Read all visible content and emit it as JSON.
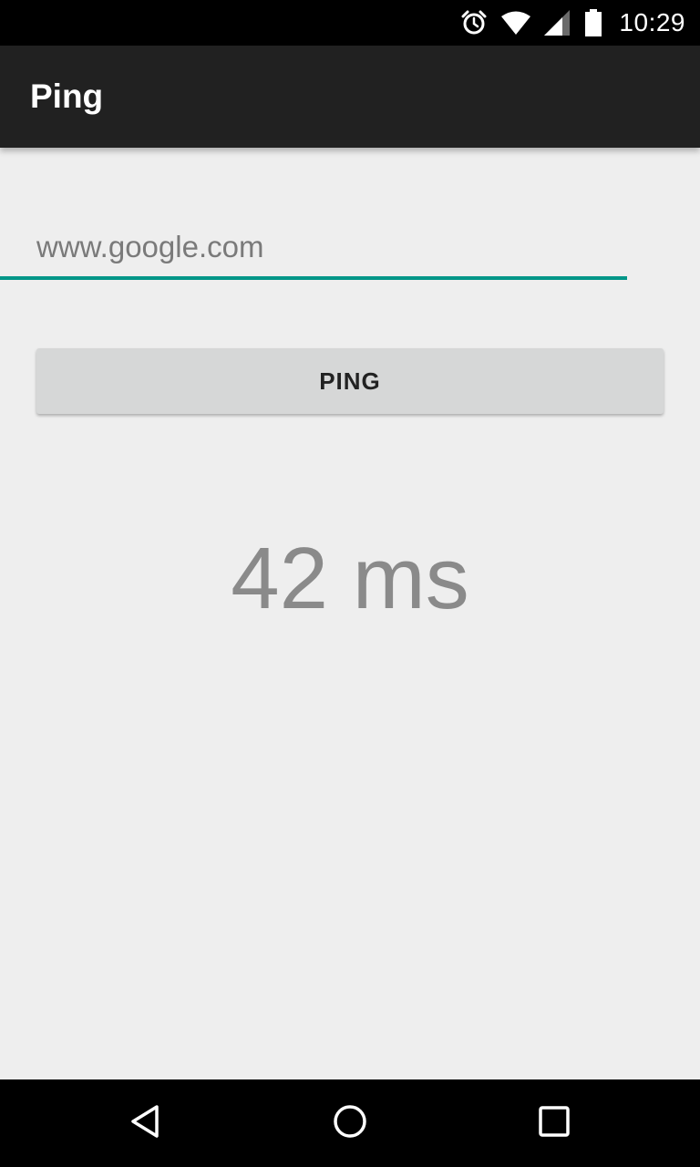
{
  "status_bar": {
    "time": "10:29",
    "icons": [
      "alarm-icon",
      "wifi-icon",
      "cell-signal-icon",
      "battery-icon"
    ]
  },
  "app_bar": {
    "title": "Ping"
  },
  "host_input": {
    "value": "www.google.com",
    "placeholder": "www.google.com"
  },
  "ping_button": {
    "label": "PING"
  },
  "result": {
    "text": "42 ms"
  },
  "nav_bar": {
    "buttons": [
      "back-icon",
      "home-icon",
      "recents-icon"
    ]
  },
  "colors": {
    "status_bar": "#000000",
    "app_bar": "#212121",
    "background": "#eeeeee",
    "accent_underline": "#009688",
    "button": "#d6d7d7",
    "result_text": "#8a8a8a"
  }
}
